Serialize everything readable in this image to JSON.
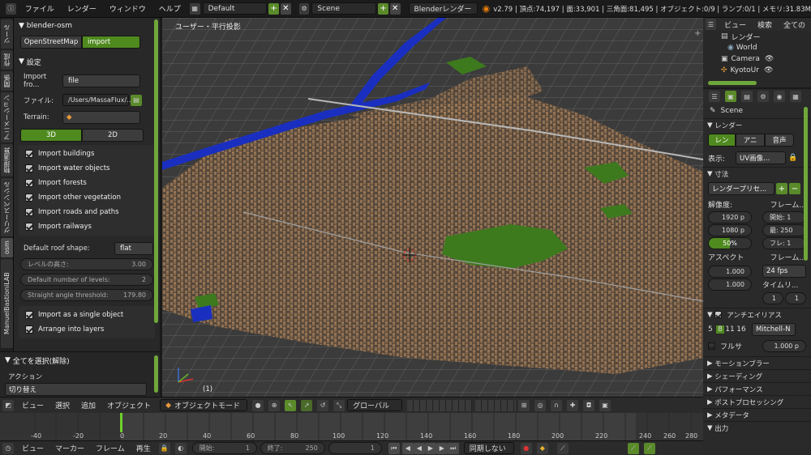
{
  "topbar": {
    "menus": [
      "ファイル",
      "レンダー",
      "ウィンドウ",
      "ヘルプ"
    ],
    "screen_layout": "Default",
    "scene": "Scene",
    "render_engine": "Blenderレンダー",
    "stats": "v2.79 | 頂点:74,197 | 面:33,901 | 三角面:81,495 | オブジェクト:0/9 | ランプ:0/1 | メモリ:31.83M"
  },
  "tabs": [
    "ツール",
    "作成",
    "関係",
    "アニメーション",
    "物理演算",
    "グリースペンシル",
    "osm",
    "ManuelBastioniLAB"
  ],
  "leftpanel": {
    "title": "blender-osm",
    "source_btn": "OpenStreetMap",
    "import_btn": "import",
    "settings_title": "設定",
    "import_from_label": "Import fro...",
    "import_from_value": "file",
    "file_label": "ファイル:",
    "file_value": "/Users/MassaFlux/...",
    "terrain_label": "Terrain:",
    "mode_3d": "3D",
    "mode_2d": "2D",
    "checks": [
      "Import buildings",
      "Import water objects",
      "Import forests",
      "Import other vegetation",
      "Import roads and paths",
      "Import railways"
    ],
    "roof_label": "Default roof shape:",
    "roof_value": "flat",
    "level_height_label": "レベルの高さ:",
    "level_height_value": "3.00",
    "levels_label": "Default number of levels:",
    "levels_value": "2",
    "angle_label": "Straight angle threshold:",
    "angle_value": "179.80",
    "single_object": "Import as a single object",
    "layers": "Arrange into layers"
  },
  "leftbottom": {
    "title": "全てを選択(解除)",
    "action_label": "アクション",
    "action_value": "切り替え"
  },
  "viewport": {
    "view_label": "ユーザー・平行投影",
    "frame_label": "(1)"
  },
  "vheader": {
    "menus": [
      "ビュー",
      "選択",
      "追加",
      "オブジェクト"
    ],
    "mode": "オブジェクトモード",
    "orientation": "グローバル"
  },
  "timeline": {
    "ticks": [
      "-40",
      "-20",
      "0",
      "20",
      "40",
      "60",
      "80",
      "100",
      "120",
      "140",
      "160",
      "180",
      "200",
      "220",
      "240",
      "260",
      "280"
    ]
  },
  "tlheader": {
    "menus": [
      "ビュー",
      "マーカー",
      "フレーム",
      "再生"
    ],
    "start_label": "開始:",
    "start_value": "1",
    "end_label": "終了:",
    "end_value": "250",
    "current_value": "1",
    "sync": "同期しない"
  },
  "outliner": {
    "menus": [
      "ビュー",
      "検索",
      "全ての"
    ],
    "items": [
      "レンダー",
      "World",
      "Camera",
      "KyotoUr"
    ]
  },
  "props": {
    "scene": "Scene",
    "render_title": "レンダー",
    "render_btns": [
      "レン",
      "アニ",
      "音声"
    ],
    "display_label": "表示:",
    "display_value": "UV画像...",
    "dimensions_title": "寸法",
    "preset": "レンダープリセ...",
    "resolution_label": "解像度:",
    "frame_range_label": "フレーム...",
    "res_x": "1920 p",
    "res_y": "1080 p",
    "res_pct": "50%",
    "start": "開始: 1",
    "end": "最: 250",
    "step": "フレ: 1",
    "aspect_label": "アスペクト",
    "framerate_label": "フレーム...",
    "aspect_x": "1.000",
    "aspect_y": "1.000",
    "fps": "24 fps",
    "timemap_label": "タイムリ...",
    "timemap_a": "1",
    "timemap_b": "1",
    "aa_title": "アンチエイリアス",
    "aa_samples": [
      "5",
      "8",
      "11",
      "16"
    ],
    "aa_filter": "Mitchell-N",
    "full_label": "フルサ",
    "full_value": "1.000 p",
    "collapsed": [
      "モーションブラー",
      "シェーディング",
      "パフォーマンス",
      "ポストプロセッシング",
      "メタデータ",
      "出力"
    ]
  },
  "colors": {
    "accent": "#5a8a2a",
    "water": "#1a2fbf",
    "building": "#8a6a4a",
    "vegetation": "#3d7a1e"
  }
}
